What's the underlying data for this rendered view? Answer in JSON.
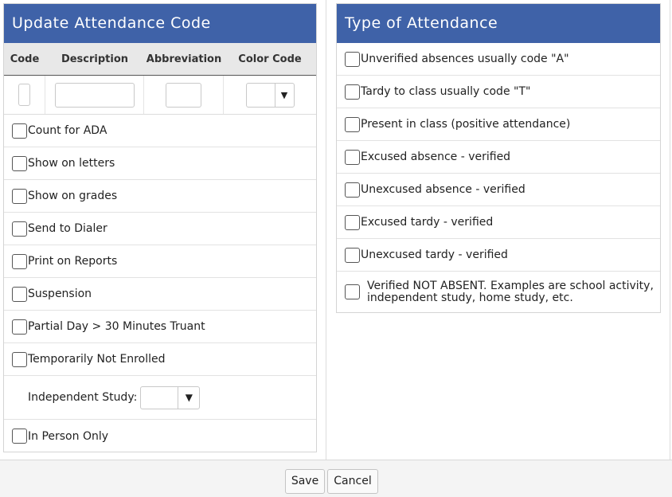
{
  "left_panel": {
    "title": "Update Attendance Code",
    "columns": [
      "Code",
      "Description",
      "Abbreviation",
      "Color Code"
    ],
    "select_arrow": "▼",
    "checkboxes": [
      {
        "label": "Count for ADA",
        "checked": false
      },
      {
        "label": "Show on letters",
        "checked": false
      },
      {
        "label": "Show on grades",
        "checked": false
      },
      {
        "label": "Send to Dialer",
        "checked": false
      },
      {
        "label": "Print on Reports",
        "checked": false
      },
      {
        "label": "Suspension",
        "checked": false
      },
      {
        "label": "Partial Day > 30 Minutes Truant",
        "checked": false
      },
      {
        "label": "Temporarily Not Enrolled",
        "checked": false
      }
    ],
    "independent_study_label": "Independent Study:",
    "independent_study_value": "",
    "in_person_only": {
      "label": "In Person Only",
      "checked": false
    },
    "inputs": {
      "code": "",
      "description": "",
      "abbreviation": "",
      "color_code": ""
    }
  },
  "right_panel": {
    "title": "Type of Attendance",
    "options": [
      {
        "label": "Unverified absences usually code \"A\"",
        "checked": false
      },
      {
        "label": "Tardy to class usually code \"T\"",
        "checked": false
      },
      {
        "label": "Present in class (positive attendance)",
        "checked": false
      },
      {
        "label": "Excused absence - verified",
        "checked": false
      },
      {
        "label": "Unexcused absence - verified",
        "checked": false
      },
      {
        "label": "Excused tardy - verified",
        "checked": false
      },
      {
        "label": "Unexcused tardy - verified",
        "checked": false
      }
    ],
    "last_option": {
      "line1": "Verified NOT ABSENT. Examples are school activity,",
      "line2": "independent study, home study, etc.",
      "checked": false
    }
  },
  "footer": {
    "save_label": "Save",
    "cancel_label": "Cancel"
  },
  "colors": {
    "header_bg": "#3f62a8",
    "header_text": "#ffffff",
    "column_header_bg": "#e8e8e8"
  }
}
